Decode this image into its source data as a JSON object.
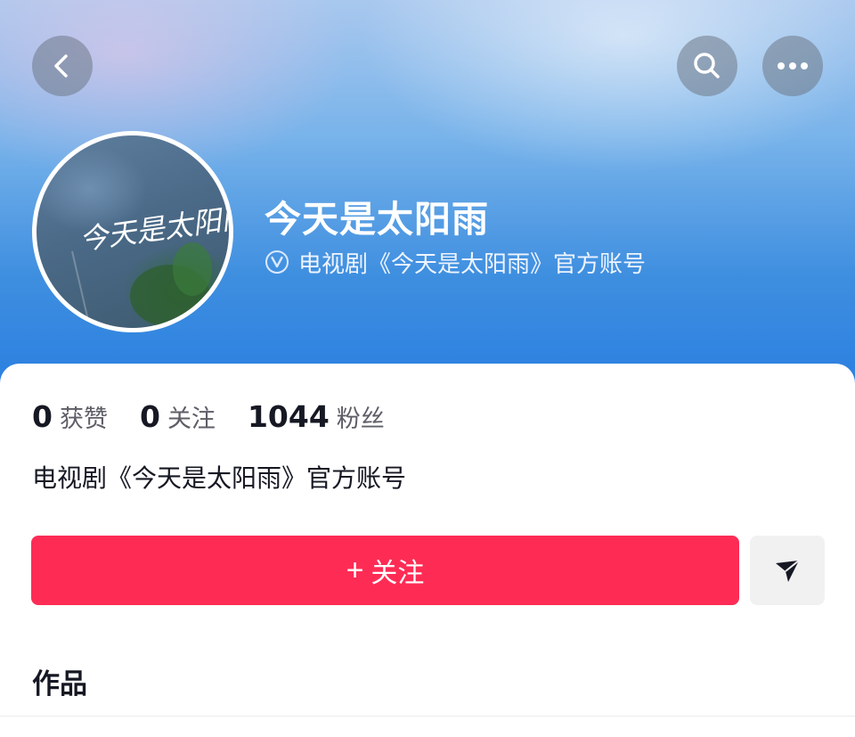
{
  "header": {
    "back_icon": "chevron-left-icon",
    "search_icon": "search-icon",
    "more_icon": "more-dots-icon"
  },
  "profile": {
    "avatar_text": "今天是太阳雨",
    "name": "今天是太阳雨",
    "verified_icon": "verified-v-icon",
    "verified_text": "电视剧《今天是太阳雨》官方账号"
  },
  "stats": [
    {
      "value": "0",
      "label": "获赞"
    },
    {
      "value": "0",
      "label": "关注"
    },
    {
      "value": "1044",
      "label": "粉丝"
    }
  ],
  "bio": "电视剧《今天是太阳雨》官方账号",
  "actions": {
    "follow_plus": "+",
    "follow_label": "关注",
    "share_icon": "paper-plane-icon"
  },
  "tabs": {
    "works_label": "作品"
  },
  "colors": {
    "follow_button": "#fe2c55",
    "header_blue": "#3f8fe0"
  }
}
